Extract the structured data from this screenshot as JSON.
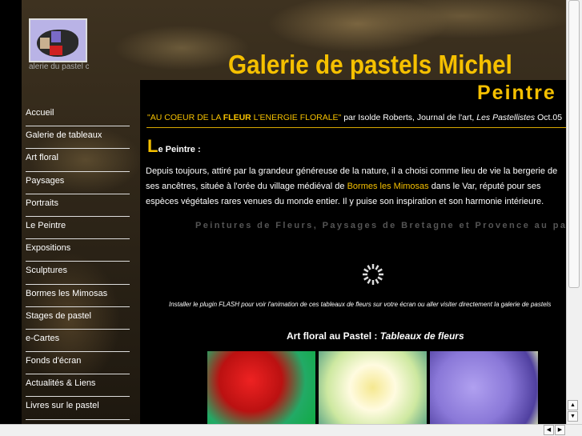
{
  "logo": {
    "caption": "alerie du pastel c"
  },
  "header": {
    "title": "Galerie de pastels Michel",
    "subtitle": "Peintre"
  },
  "menu": [
    "Accueil",
    "Galerie de tableaux",
    "Art floral",
    "Paysages",
    "Portraits",
    "Le Peintre",
    "Expositions",
    "Sculptures",
    "Bormes les Mimosas",
    "Stages de pastel",
    "e-Cartes",
    "Fonds d'écran",
    "Actualités & Liens",
    "Livres sur le pastel"
  ],
  "quote": {
    "part1": "\"AU COEUR DE LA ",
    "bold": "FLEUR",
    "part2": " L'ENERGIE FLORALE\"",
    "by": " par Isolde Roberts, Journal de l'art, ",
    "journal": "Les Pastellistes",
    "date": " Oct.05"
  },
  "section": {
    "initial": "L",
    "rest": "e Peintre :"
  },
  "paragraph": {
    "before": "Depuis toujours, attiré par la grandeur généreuse de la nature, il a choisi comme lieu de vie la bergerie de ses ancêtres, située à l'orée du village médiéval de ",
    "link": "Bormes les Mimosas",
    "after": " dans le Var, réputé pour ses espèces végétales rares venues du monde entier. Il y puise son inspiration et son harmonie intérieure."
  },
  "tagline": "Peintures de Fleurs, Paysages de Bretagne et Provence au pastel sec",
  "flash_notice": "Installer le plugin FLASH pour voir l'animation de ces tableaux de fleurs sur votre écran ou aller visiter directement la galerie de pastels",
  "art_floral": {
    "label": "Art floral au Pastel : ",
    "italic": "Tableaux de fleurs"
  },
  "colors": {
    "accent": "#f5c000",
    "background": "#000000"
  }
}
